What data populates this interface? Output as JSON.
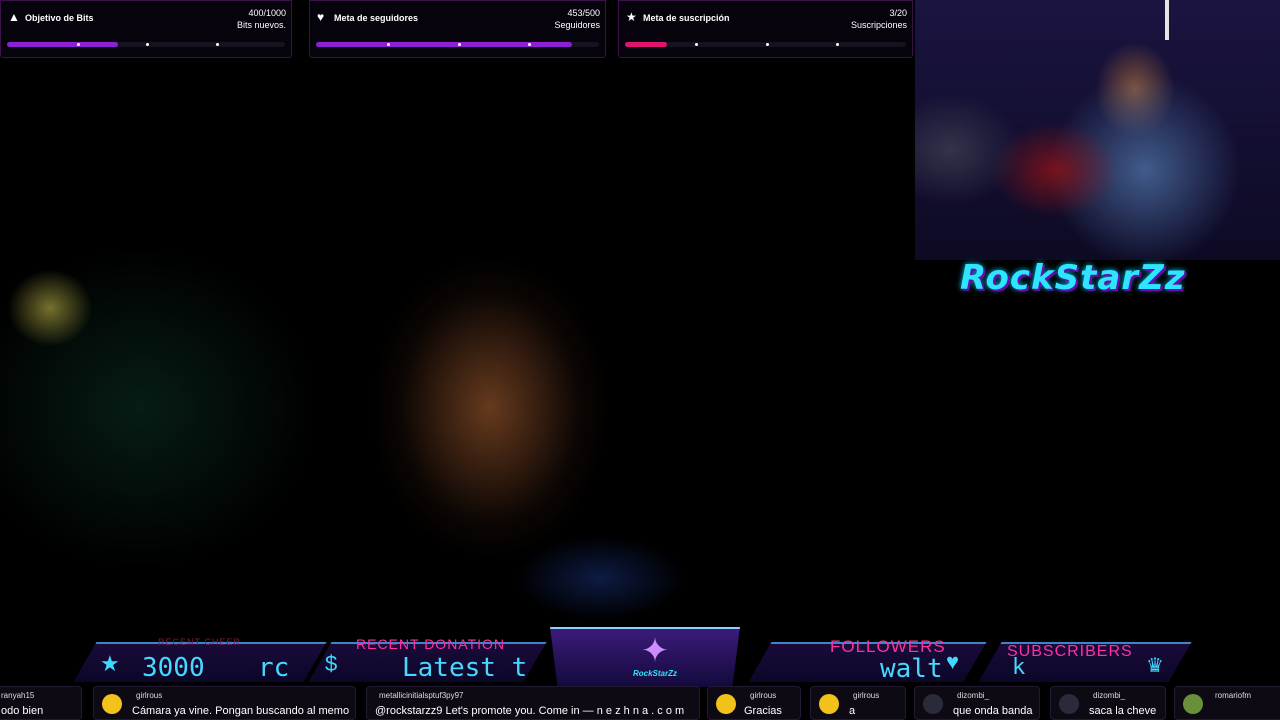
{
  "goals": [
    {
      "title": "Objetivo de Bits",
      "amount": "400/1000",
      "unit": "Bits nuevos.",
      "progress": 0.4,
      "color": "#8d1fd4",
      "icon": "bits-icon"
    },
    {
      "title": "Meta de seguidores",
      "amount": "453/500",
      "unit": "Seguidores",
      "progress": 0.906,
      "color": "#8d1fd4",
      "icon": "heart-icon"
    },
    {
      "title": "Meta de suscripción",
      "amount": "3/20",
      "unit": "Suscripciones",
      "progress": 0.15,
      "color": "#e0146f",
      "icon": "star-icon"
    }
  ],
  "logo": {
    "text": "RockStarZz"
  },
  "bottom_bar": {
    "cheer_label": "RECENT CHEER",
    "cheer_value": "3000",
    "cheer_extra": "rc",
    "donation_label": "RECENT DONATION",
    "donation_value": "Latest t",
    "center_text": "RockStarZz",
    "followers_label": "FOLLOWERS",
    "followers_value": "walt",
    "subscribers_label": "SUBSCRIBERS",
    "subscribers_value": "k"
  },
  "chat": [
    {
      "user": "ranyah15",
      "text": "odo bien",
      "avatar_color": "#333"
    },
    {
      "user": "girlrous",
      "text": "Cámara ya vine. Pongan buscando al memo",
      "avatar_color": "#f2c21b"
    },
    {
      "user": "metallicinitialsptuf3py97",
      "text": "@rockstarzz9 Let's promote you. Come in — n e z h n a . c o m",
      "avatar_color": "#1fc36a"
    },
    {
      "user": "girlrous",
      "text": "Gracias",
      "avatar_color": "#f2c21b"
    },
    {
      "user": "girlrous",
      "text": "a",
      "avatar_color": "#f2c21b"
    },
    {
      "user": "dizombi_",
      "text": "que onda banda",
      "avatar_color": "#2a2a3a"
    },
    {
      "user": "dizombi_",
      "text": "saca la cheve",
      "avatar_color": "#2a2a3a"
    },
    {
      "user": "romariofm",
      "text": "",
      "avatar_color": "#6a8f3a"
    }
  ]
}
